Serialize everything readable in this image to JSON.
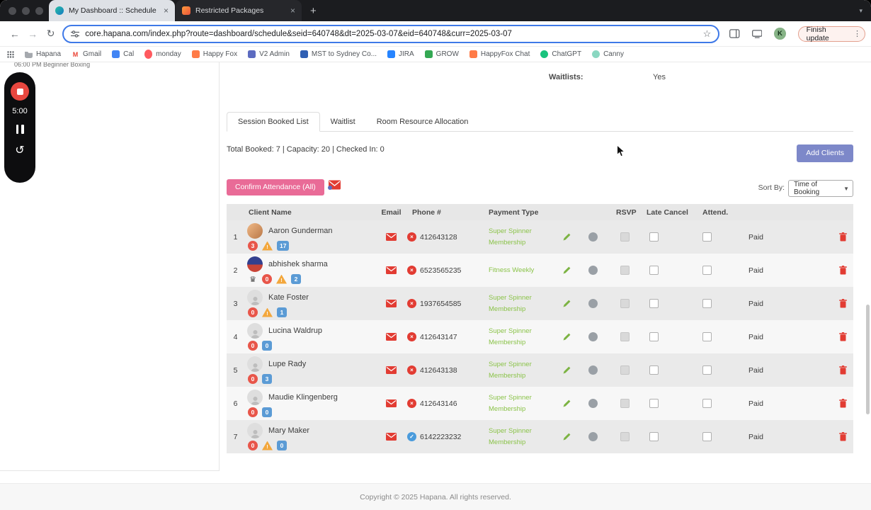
{
  "window": {
    "tabs": [
      {
        "title": "My Dashboard :: Schedule",
        "active": true
      },
      {
        "title": "Restricted Packages",
        "active": false
      }
    ]
  },
  "toolbar": {
    "url": "core.hapana.com/index.php?route=dashboard/schedule&seid=640748&dt=2025-03-07&eid=640748&curr=2025-03-07",
    "finish_update_label": "Finish update",
    "avatar_letter": "K"
  },
  "bookmarks": {
    "items": [
      {
        "label": "Hapana",
        "icon": "folder",
        "color": "#a5a9ae"
      },
      {
        "label": "Gmail",
        "icon": "gmail",
        "color": "#ea4335"
      },
      {
        "label": "Cal",
        "icon": "square",
        "color": "#4285f4"
      },
      {
        "label": "monday",
        "icon": "dot",
        "color": "#ff5a5f"
      },
      {
        "label": "Happy Fox",
        "icon": "square",
        "color": "#ff7b47"
      },
      {
        "label": "V2 Admin",
        "icon": "square",
        "color": "#5c6bc0"
      },
      {
        "label": "MST to Sydney Co...",
        "icon": "square",
        "color": "#2f5fb3"
      },
      {
        "label": "JIRA",
        "icon": "square",
        "color": "#2684ff"
      },
      {
        "label": "GROW",
        "icon": "square",
        "color": "#34a853"
      },
      {
        "label": "HappyFox Chat",
        "icon": "square",
        "color": "#ff7b47"
      },
      {
        "label": "ChatGPT",
        "icon": "circle",
        "color": "#19c37d"
      },
      {
        "label": "Canny",
        "icon": "circle",
        "color": "#8ad7c1"
      }
    ]
  },
  "recorder": {
    "time": "5:00"
  },
  "sidebar": {
    "session_title": "06:00 PM Beginner Boxing"
  },
  "main": {
    "waitlists_label": "Waitlists:",
    "waitlists_value": "Yes",
    "tabs": [
      {
        "label": "Session Booked List",
        "active": true
      },
      {
        "label": "Waitlist",
        "active": false
      },
      {
        "label": "Room Resource Allocation",
        "active": false
      }
    ],
    "summary": "Total Booked: 7 | Capacity: 20 | Checked In: 0",
    "add_clients_label": "Add Clients",
    "confirm_attendance_label": "Confirm Attendance (All)",
    "sort_by_label": "Sort By:",
    "sort_by_value": "Time of Booking",
    "table": {
      "headers": {
        "client": "Client Name",
        "email": "Email",
        "phone": "Phone #",
        "payment": "Payment Type",
        "rsvp": "RSVP",
        "late_cancel": "Late Cancel",
        "attend": "Attend."
      },
      "rows": [
        {
          "index": "1",
          "name": "Aaron Gunderman",
          "avatar": "photo",
          "badges": [
            {
              "type": "red",
              "value": "3"
            },
            {
              "type": "warning",
              "value": "!"
            },
            {
              "type": "blue",
              "value": "17"
            }
          ],
          "phone": "412643128",
          "phone_status": "invalid",
          "payment": "Super Spinner Membership",
          "paid": "Paid"
        },
        {
          "index": "2",
          "name": "abhishek sharma",
          "avatar": "flag",
          "badges": [
            {
              "type": "crown",
              "value": "♛"
            },
            {
              "type": "red",
              "value": "0"
            },
            {
              "type": "warning",
              "value": "!"
            },
            {
              "type": "blue",
              "value": "2"
            }
          ],
          "phone": "6523565235",
          "phone_status": "invalid",
          "payment": "Fitness Weekly",
          "paid": "Paid"
        },
        {
          "index": "3",
          "name": "Kate Foster",
          "avatar": "placeholder",
          "badges": [
            {
              "type": "red",
              "value": "0"
            },
            {
              "type": "warning",
              "value": "!"
            },
            {
              "type": "blue",
              "value": "1"
            }
          ],
          "phone": "1937654585",
          "phone_status": "invalid",
          "payment": "Super Spinner Membership",
          "paid": "Paid"
        },
        {
          "index": "4",
          "name": "Lucina Waldrup",
          "avatar": "placeholder",
          "badges": [
            {
              "type": "red",
              "value": "0"
            },
            {
              "type": "blue",
              "value": "0"
            }
          ],
          "phone": "412643147",
          "phone_status": "invalid",
          "payment": "Super Spinner Membership",
          "paid": "Paid"
        },
        {
          "index": "5",
          "name": "Lupe Rady",
          "avatar": "placeholder",
          "badges": [
            {
              "type": "red",
              "value": "0"
            },
            {
              "type": "blue",
              "value": "3"
            }
          ],
          "phone": "412643138",
          "phone_status": "invalid",
          "payment": "Super Spinner Membership",
          "paid": "Paid"
        },
        {
          "index": "6",
          "name": "Maudie Klingenberg",
          "avatar": "placeholder",
          "badges": [
            {
              "type": "red",
              "value": "0"
            },
            {
              "type": "blue",
              "value": "0"
            }
          ],
          "phone": "412643146",
          "phone_status": "invalid",
          "payment": "Super Spinner Membership",
          "paid": "Paid"
        },
        {
          "index": "7",
          "name": "Mary Maker",
          "avatar": "placeholder",
          "badges": [
            {
              "type": "red",
              "value": "0"
            },
            {
              "type": "warning",
              "value": "!"
            },
            {
              "type": "blue",
              "value": "0"
            }
          ],
          "phone": "6142223232",
          "phone_status": "valid",
          "payment": "Super Spinner Membership",
          "paid": "Paid"
        }
      ]
    }
  },
  "footer": {
    "copyright": "Copyright © 2025 Hapana. All rights reserved."
  },
  "colors": {
    "accent_pink": "#e96b97",
    "accent_indigo": "#7d88c9",
    "success_green": "#8bc34a",
    "error_red": "#e23c33",
    "info_blue": "#5b9bd5",
    "url_focus_blue": "#3e79e8"
  }
}
